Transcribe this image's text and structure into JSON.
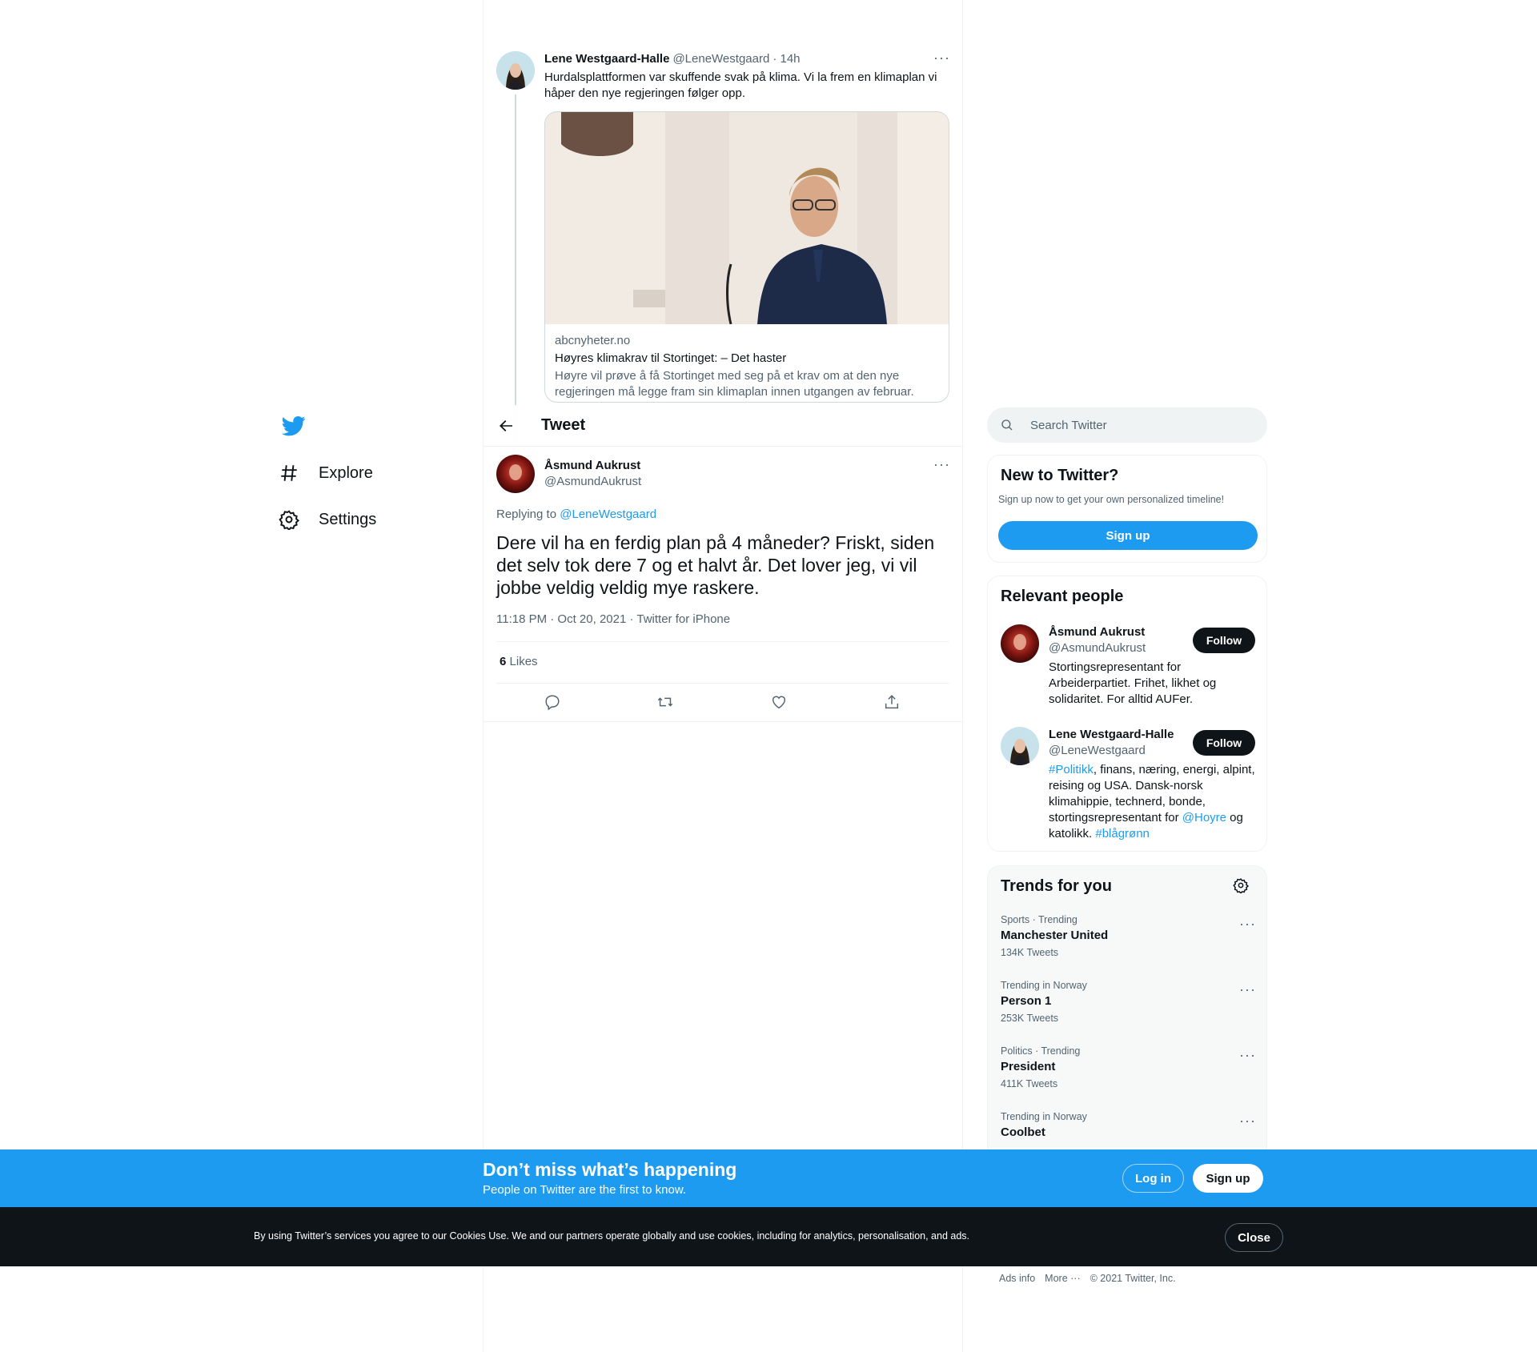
{
  "colors": {
    "accent": "#1d9bf0",
    "text": "#0f1419",
    "muted": "#536471",
    "border": "#eff3f4"
  },
  "nav": {
    "logo_icon": "twitter-bird-icon",
    "items": [
      {
        "label": "Explore",
        "icon": "hashtag-icon"
      },
      {
        "label": "Settings",
        "icon": "gear-icon"
      }
    ]
  },
  "parent_tweet": {
    "name": "Lene Westgaard-Halle",
    "handle": "@LeneWestgaard",
    "time": "· 14h",
    "text": "Hurdalsplattformen var skuffende svak på klima. Vi la frem en klimaplan vi håper den nye regjeringen følger opp.",
    "card": {
      "domain": "abcnyheter.no",
      "title": "Høyres klimakrav til Stortinget: – Det haster",
      "description": "Høyre vil prøve å få Stortinget med seg på et krav om at den nye regjeringen må legge fram sin klimaplan innen utgangen av februar."
    }
  },
  "header": {
    "title": "Tweet",
    "back_icon": "back-arrow-icon"
  },
  "tweet": {
    "name": "Åsmund Aukrust",
    "handle": "@AsmundAukrust",
    "replying_prefix": "Replying to",
    "replying_to": "@LeneWestgaard",
    "text": "Dere vil ha en ferdig plan på 4 måneder? Friskt, siden det selv tok dere 7 og et halvt år. Det lover jeg, vi vil jobbe veldig veldig mye raskere.",
    "meta": "11:18 PM · Oct 20, 2021 · Twitter for iPhone",
    "likes_count": "6",
    "likes_label": "Likes",
    "actions": [
      "reply-icon",
      "retweet-icon",
      "like-icon",
      "share-icon"
    ]
  },
  "search": {
    "placeholder": "Search Twitter"
  },
  "new_to_twitter": {
    "title": "New to Twitter?",
    "subtitle": "Sign up now to get your own personalized timeline!",
    "button": "Sign up"
  },
  "relevant_people": {
    "title": "Relevant people",
    "people": [
      {
        "name": "Åsmund Aukrust",
        "handle": "@AsmundAukrust",
        "button": "Follow",
        "bio": "Stortingsrepresentant for Arbeiderpartiet. Frihet, likhet og solidaritet. For alltid AUFer."
      },
      {
        "name": "Lene Westgaard-Halle",
        "handle": "@LeneWestgaard",
        "button": "Follow",
        "bio_parts": {
          "tag1": "#Politikk",
          "text1": ", finans, næring, energi, alpint, reising og USA. Dansk-norsk klimahippie, technerd, bonde, stortingsrepresentant for ",
          "mention": "@Hoyre",
          "text2": " og katolikk. ",
          "tag2": "#blågrønn"
        }
      }
    ]
  },
  "trends": {
    "title": "Trends for you",
    "items": [
      {
        "meta": "Sports · Trending",
        "name": "Manchester United",
        "count": "134K Tweets"
      },
      {
        "meta": "Trending in Norway",
        "name": "Person 1",
        "count": "253K Tweets"
      },
      {
        "meta": "Politics · Trending",
        "name": "President",
        "count": "411K Tweets"
      },
      {
        "meta": "Trending in Norway",
        "name": "Coolbet",
        "count": ""
      }
    ]
  },
  "footer": {
    "ads_info": "Ads info",
    "more": "More ···",
    "copyright": "© 2021 Twitter, Inc."
  },
  "banner": {
    "title": "Don’t miss what’s happening",
    "subtitle": "People on Twitter are the first to know.",
    "login": "Log in",
    "signup": "Sign up"
  },
  "cookie": {
    "text": "By using Twitter’s services you agree to our Cookies Use. We and our partners operate globally and use cookies, including for analytics, personalisation, and ads.",
    "close": "Close"
  }
}
